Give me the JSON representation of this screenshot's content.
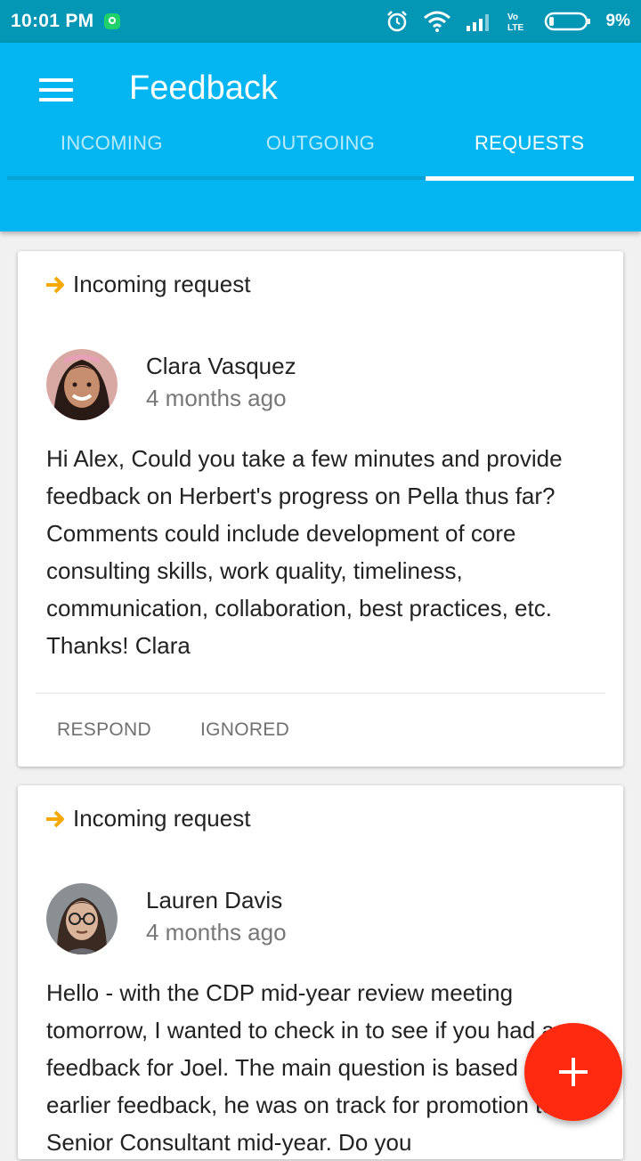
{
  "status_bar": {
    "time": "10:01 PM",
    "battery_percent": "9%",
    "icons": [
      "app-notification-icon",
      "alarm-icon",
      "wifi-icon",
      "signal-icon",
      "volte-icon",
      "battery-icon"
    ]
  },
  "app_bar": {
    "title": "Feedback",
    "menu_icon": "hamburger-menu-icon",
    "color": "#03b5f0"
  },
  "tabs": [
    {
      "label": "INCOMING",
      "active": false
    },
    {
      "label": "OUTGOING",
      "active": false
    },
    {
      "label": "REQUESTS",
      "active": true
    }
  ],
  "requests": [
    {
      "type_label": "Incoming request",
      "type_icon": "arrow-right-icon",
      "name": "Clara Vasquez",
      "time": "4 months ago",
      "message": "Hi Alex,  Could you take a few minutes and provide feedback on Herbert's progress on Pella thus far? Comments could include development of core consulting skills, work quality, timeliness, communication, collaboration, best practices, etc.  Thanks! Clara",
      "actions": [
        "RESPOND",
        "IGNORED"
      ]
    },
    {
      "type_label": "Incoming request",
      "type_icon": "arrow-right-icon",
      "name": "Lauren Davis",
      "time": "4 months ago",
      "message": "Hello - with the CDP mid-year review meeting tomorrow, I wanted to check in to see if you had any feedback for Joel. The main question is based on his earlier feedback, he was on track for promotion to Senior Consultant mid-year. Do you"
    }
  ],
  "fab": {
    "icon": "plus-icon",
    "color": "#ff2a10"
  },
  "accent_arrow_color": "#f5a900"
}
